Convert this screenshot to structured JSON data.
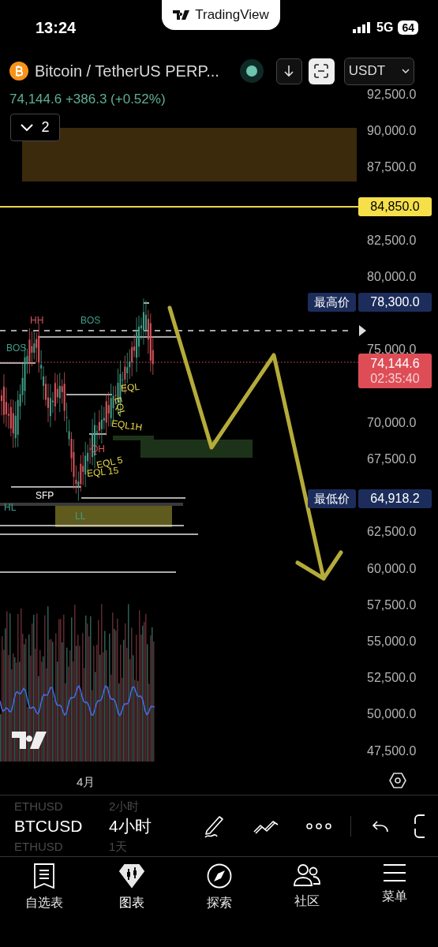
{
  "status_bar": {
    "time": "13:24",
    "network": "5G",
    "battery": "64"
  },
  "island": {
    "brand": "TradingView"
  },
  "header": {
    "symbol": "Bitcoin / TetherUS PERP...",
    "live": true,
    "currency": "USDT",
    "price": "74,144.6",
    "change": "+386.3 (+0.52%)",
    "indicators_count": "2"
  },
  "price_axis": {
    "ticks": [
      "92,500.0",
      "90,000.0",
      "87,500.0",
      "82,500.0",
      "80,000.0",
      "75,000.0",
      "70,000.0",
      "67,500.0",
      "62,500.0",
      "60,000.0",
      "57,500.0",
      "55,000.0",
      "52,500.0",
      "50,000.0",
      "47,500.0"
    ],
    "alert_price": "84,850.0",
    "high_label": "最高价",
    "high_price": "78,300.0",
    "last_price": "74,144.6",
    "countdown": "02:35:40",
    "low_label": "最低价",
    "low_price": "64,918.2"
  },
  "chart_labels": [
    {
      "text": "HH",
      "kind": "bear"
    },
    {
      "text": "BOS",
      "kind": "bull"
    },
    {
      "text": "BOS",
      "kind": "bull"
    },
    {
      "text": "EQL",
      "kind": "eq"
    },
    {
      "text": "EQL",
      "kind": "eq"
    },
    {
      "text": "EQL1H",
      "kind": "eq"
    },
    {
      "text": "QH",
      "kind": "bear"
    },
    {
      "text": "EQL 5",
      "kind": "eq"
    },
    {
      "text": "EQL 15",
      "kind": "eq"
    },
    {
      "text": "SFP",
      "kind": "plain"
    },
    {
      "text": "HL",
      "kind": "bull"
    },
    {
      "text": "LL",
      "kind": "bull"
    }
  ],
  "time_axis": {
    "label": "4月"
  },
  "toolbar": {
    "symbols": [
      {
        "text": "ETHUSD",
        "selected": false
      },
      {
        "text": "BTCUSD",
        "selected": true
      },
      {
        "text": "ETHUSD",
        "selected": false
      }
    ],
    "intervals": [
      {
        "text": "2小时",
        "selected": false
      },
      {
        "text": "4小时",
        "selected": true
      },
      {
        "text": "1天",
        "selected": false
      }
    ]
  },
  "tab_bar": [
    {
      "label": "自选表",
      "selected": false
    },
    {
      "label": "图表",
      "selected": true
    },
    {
      "label": "探索",
      "selected": false
    },
    {
      "label": "社区",
      "selected": false
    },
    {
      "label": "菜单",
      "selected": false
    }
  ]
}
